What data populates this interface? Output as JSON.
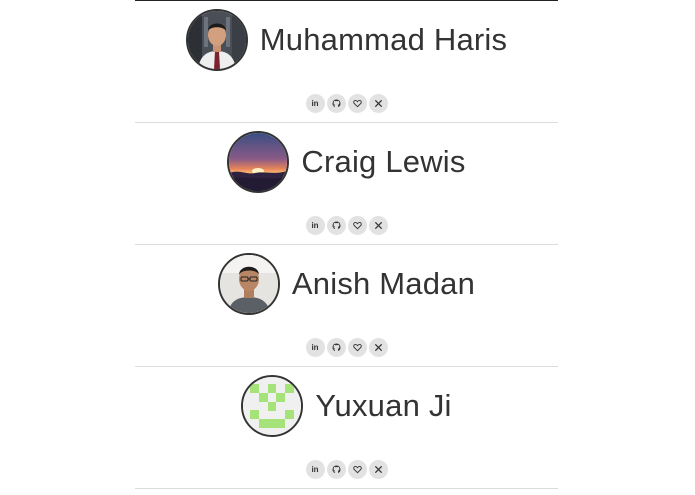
{
  "members": [
    {
      "name": "Muhammad Haris",
      "avatar": "photo-avatar",
      "socials": [
        {
          "label": "in",
          "icon": "linkedin-icon"
        },
        {
          "label": "",
          "icon": "github-icon"
        },
        {
          "label": "",
          "icon": "heart-icon"
        },
        {
          "label": "",
          "icon": "x-twitter-icon"
        }
      ]
    },
    {
      "name": "Craig Lewis",
      "avatar": "sunset-landscape-avatar",
      "socials": [
        {
          "label": "in",
          "icon": "linkedin-icon"
        },
        {
          "label": "",
          "icon": "github-icon"
        },
        {
          "label": "",
          "icon": "heart-icon"
        },
        {
          "label": "",
          "icon": "x-twitter-icon"
        }
      ]
    },
    {
      "name": "Anish Madan",
      "avatar": "photo-avatar",
      "socials": [
        {
          "label": "in",
          "icon": "linkedin-icon"
        },
        {
          "label": "",
          "icon": "github-icon"
        },
        {
          "label": "",
          "icon": "heart-icon"
        },
        {
          "label": "",
          "icon": "x-twitter-icon"
        }
      ]
    },
    {
      "name": "Yuxuan Ji",
      "avatar": "identicon-avatar",
      "socials": [
        {
          "label": "in",
          "icon": "linkedin-icon"
        },
        {
          "label": "",
          "icon": "github-icon"
        },
        {
          "label": "",
          "icon": "heart-icon"
        },
        {
          "label": "",
          "icon": "x-twitter-icon"
        }
      ]
    }
  ],
  "colors": {
    "text": "#333333",
    "social_bg": "#e2e2e2",
    "divider": "#dcdcdc",
    "identicon": "#a6e27a"
  }
}
